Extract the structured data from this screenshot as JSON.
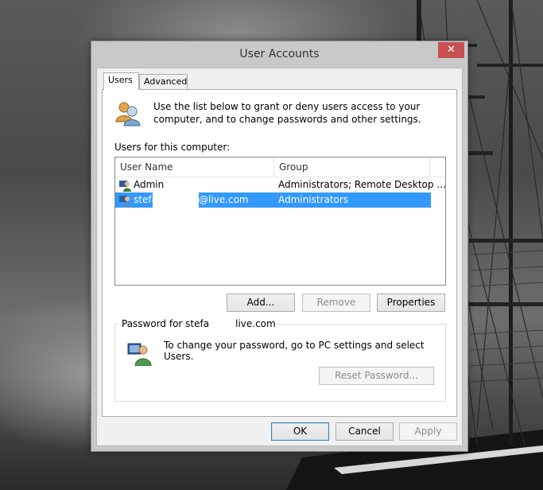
{
  "window": {
    "title": "User Accounts",
    "close_label": "✕"
  },
  "tabs": [
    {
      "label": "Users",
      "active": true
    },
    {
      "label": "Advanced",
      "active": false
    }
  ],
  "users_tab": {
    "intro_text": "Use the list below to grant or deny users access to your computer, and to change passwords and other settings.",
    "list_label": "Users for this computer:",
    "columns": [
      "User Name",
      "Group"
    ],
    "rows": [
      {
        "name": "Admin",
        "group": "Administrators; Remote Desktop ...",
        "selected": false
      },
      {
        "name": "stefa",
        "name_suffix": "@live.com",
        "group": "Administrators",
        "selected": true
      }
    ],
    "buttons": {
      "add": "Add...",
      "remove": "Remove",
      "properties": "Properties"
    },
    "password_group": {
      "legend_prefix": "Password for stefa",
      "legend_suffix": "live.com",
      "text": "To change your password, go to PC settings and select Users.",
      "reset_button": "Reset Password..."
    }
  },
  "footer_buttons": {
    "ok": "OK",
    "cancel": "Cancel",
    "apply": "Apply"
  },
  "colors": {
    "selection": "#3399ff",
    "close_button": "#c75050"
  }
}
